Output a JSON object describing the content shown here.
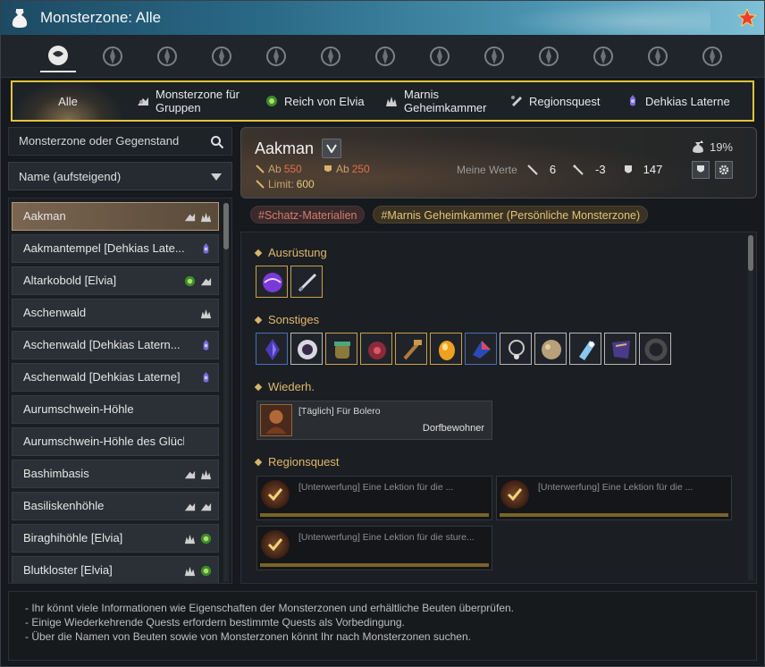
{
  "window": {
    "title": "Monsterzone: Alle"
  },
  "category_icons": [
    "all-icon",
    "horse-icon",
    "lion-icon",
    "eagle-icon",
    "crescent-icon",
    "valencia-icon",
    "calpheon-icon",
    "serendia-icon",
    "kamasylvia-icon",
    "drieghan-icon",
    "odyllita-icon",
    "mountain-icon",
    "edania-icon"
  ],
  "filters": [
    {
      "label": "Alle",
      "icon": ""
    },
    {
      "label": "Monsterzone für Gruppen",
      "icon": "party-icon"
    },
    {
      "label": "Reich von Elvia",
      "icon": "elvia-icon"
    },
    {
      "label": "Marnis Geheimkammer",
      "icon": "marni-icon"
    },
    {
      "label": "Regionsquest",
      "icon": "region-quest-icon"
    },
    {
      "label": "Dehkias Laterne",
      "icon": "lantern-icon"
    }
  ],
  "search": {
    "placeholder": "Monsterzone oder Gegenstand"
  },
  "sort": {
    "label": "Name (aufsteigend)"
  },
  "zones": [
    {
      "name": "Aakman",
      "icons": [
        "party-icon",
        "marni-icon"
      ],
      "selected": true
    },
    {
      "name": "Aakmantempel [Dehkias Late...",
      "icons": [
        "lantern-icon"
      ]
    },
    {
      "name": "Altarkobold [Elvia]",
      "icons": [
        "elvia-icon",
        "party-icon"
      ]
    },
    {
      "name": "Aschenwald",
      "icons": [
        "marni-icon"
      ]
    },
    {
      "name": "Aschenwald [Dehkias Latern...",
      "icons": [
        "lantern-icon"
      ]
    },
    {
      "name": "Aschenwald [Dehkias Laterne]",
      "icons": [
        "lantern-icon"
      ]
    },
    {
      "name": "Aurumschwein-Höhle",
      "icons": []
    },
    {
      "name": "Aurumschwein-Höhle des Glücks",
      "icons": []
    },
    {
      "name": "Bashimbasis",
      "icons": [
        "party-icon",
        "marni-icon"
      ]
    },
    {
      "name": "Basiliskenhöhle",
      "icons": [
        "party-icon",
        "party-icon"
      ]
    },
    {
      "name": "Biraghihöhle [Elvia]",
      "icons": [
        "marni-icon",
        "elvia-icon"
      ]
    },
    {
      "name": "Blutkloster [Elvia]",
      "icons": [
        "marni-icon",
        "elvia-icon"
      ]
    }
  ],
  "detail": {
    "name": "Aakman",
    "loot_percent": "19%",
    "ap_label": "Ab",
    "ap_value": "550",
    "dp_label": "Ab",
    "dp_value": "250",
    "limit_label": "Limit:",
    "limit_value": "600",
    "my_values_label": "Meine Werte",
    "my_ap": "6",
    "my_aap": "-3",
    "my_dp": "147"
  },
  "tags": [
    "#Schatz-Materialien",
    "#Marnis Geheimkammer (Persönliche Monsterzone)"
  ],
  "sections": {
    "equipment": "Ausrüstung",
    "misc": "Sonstiges",
    "daily": "Wiederh.",
    "region": "Regionsquest"
  },
  "equipment_items": [
    {
      "icon": "purple-orb-icon",
      "rarity": "gold"
    },
    {
      "icon": "dagger-icon",
      "rarity": "gold"
    }
  ],
  "misc_items": [
    {
      "icon": "crystal-icon",
      "rarity": "blue"
    },
    {
      "icon": "black-stone-icon",
      "rarity": "white"
    },
    {
      "icon": "pot-icon",
      "rarity": "gold"
    },
    {
      "icon": "pouch-icon",
      "rarity": "gold"
    },
    {
      "icon": "hammer-icon",
      "rarity": "gold"
    },
    {
      "icon": "gem-icon",
      "rarity": "gold"
    },
    {
      "icon": "shard-icon",
      "rarity": "blue"
    },
    {
      "icon": "necklace-icon",
      "rarity": "white"
    },
    {
      "icon": "ore-icon",
      "rarity": "white"
    },
    {
      "icon": "potion-icon",
      "rarity": "white"
    },
    {
      "icon": "cloth-icon",
      "rarity": "white"
    },
    {
      "icon": "ring-icon",
      "rarity": "white"
    }
  ],
  "daily_quest": {
    "title": "[Täglich] Für Bolero",
    "sub": "Dorfbewohner"
  },
  "region_quests": [
    {
      "title": "[Unterwerfung] Eine Lektion für die ..."
    },
    {
      "title": "[Unterwerfung] Eine Lektion für die ..."
    },
    {
      "title": "[Unterwerfung] Eine Lektion für die sture..."
    }
  ],
  "footer": [
    "- Ihr könnt viele Informationen wie Eigenschaften der Monsterzonen und erhältliche Beuten überprüfen.",
    "- Einige Wiederkehrende Quests erfordern bestimmte Quests als Vorbedingung.",
    "- Über die Namen von Beuten sowie von Monsterzonen könnt Ihr nach Monsterzonen suchen."
  ],
  "colors": {
    "accent_border": "#e2c33b",
    "title_bar": "#2a6a87",
    "ap_value": "#e07049",
    "tag_gold": "#e3c47a"
  }
}
